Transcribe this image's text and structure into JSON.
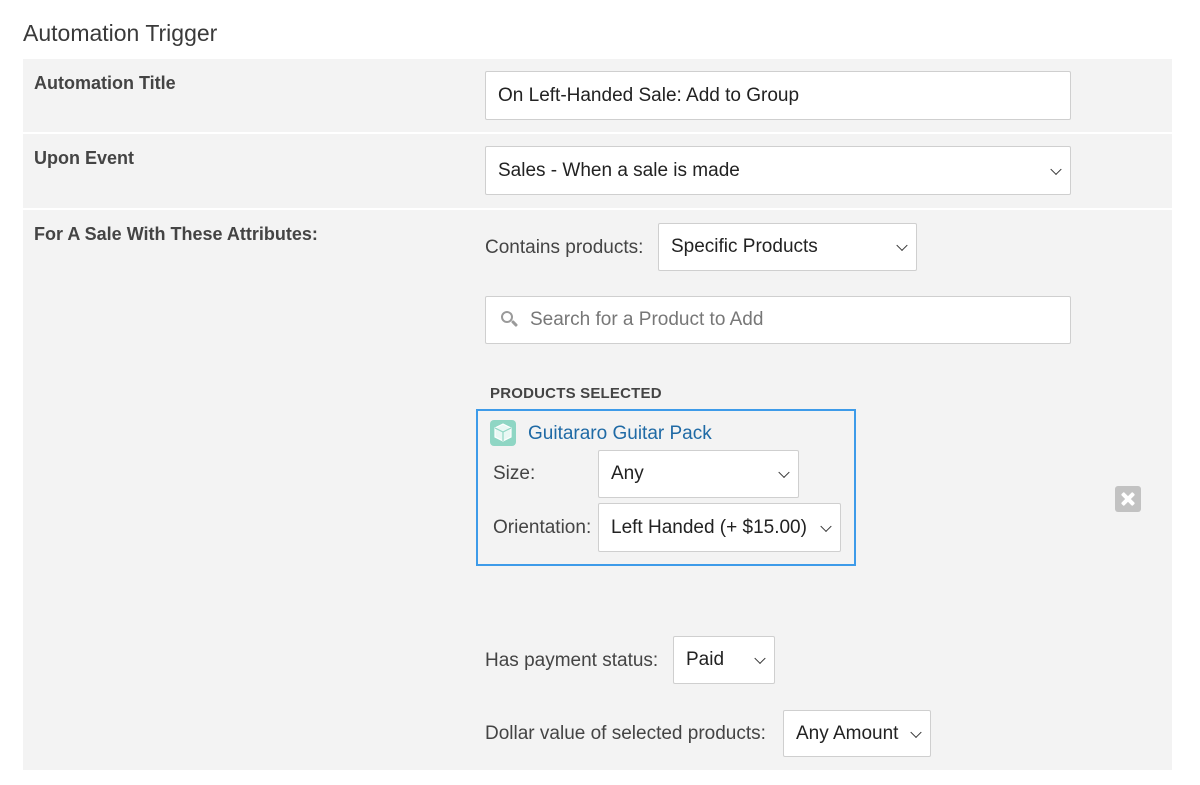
{
  "page": {
    "title": "Automation Trigger"
  },
  "automation_title": {
    "label": "Automation Title",
    "value": "On Left-Handed Sale: Add to Group"
  },
  "upon_event": {
    "label": "Upon Event",
    "selected": "Sales - When a sale is made"
  },
  "sale_attributes": {
    "label": "For A Sale With These Attributes:",
    "contains_products": {
      "label": "Contains products:",
      "selected": "Specific Products"
    },
    "search": {
      "placeholder": "Search for a Product to Add",
      "icon": "search-icon"
    },
    "products_selected": {
      "heading": "PRODUCTS SELECTED",
      "items": [
        {
          "name": "Guitararo Guitar Pack",
          "icon": "product-box-icon",
          "size": {
            "label": "Size:",
            "selected": "Any"
          },
          "orientation": {
            "label": "Orientation:",
            "selected": "Left Handed (+ $15.00)"
          }
        }
      ],
      "remove_icon": "close-icon"
    },
    "payment_status": {
      "label": "Has payment status:",
      "selected": "Paid"
    },
    "dollar_value": {
      "label": "Dollar value of selected products:",
      "selected": "Any Amount"
    }
  },
  "colors": {
    "row_bg": "#f3f3f3",
    "accent_border": "#3d9be9",
    "product_link": "#1f6aa5",
    "product_icon": "#8fd6c4"
  }
}
